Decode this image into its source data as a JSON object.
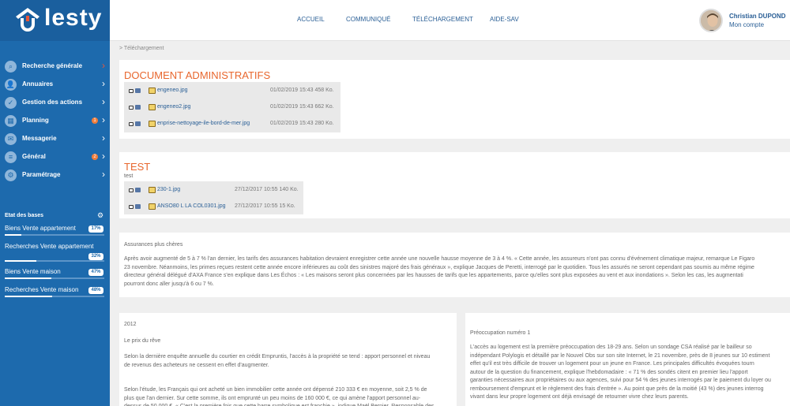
{
  "app": {
    "name": "lesty"
  },
  "nav": {
    "items": [
      {
        "label": "Recherche générale",
        "icon": "search-icon",
        "glyph": "⌕",
        "chev": "red"
      },
      {
        "label": "Annuaires",
        "icon": "user-icon",
        "glyph": "👤",
        "chev": ""
      },
      {
        "label": "Gestion des actions",
        "icon": "check-icon",
        "glyph": "✓",
        "chev": ""
      },
      {
        "label": "Planning",
        "icon": "calendar-icon",
        "glyph": "▦",
        "chev": "",
        "badge": "1"
      },
      {
        "label": "Messagerie",
        "icon": "envelope-icon",
        "glyph": "✉",
        "chev": ""
      },
      {
        "label": "Général",
        "icon": "database-icon",
        "glyph": "≡",
        "chev": "",
        "badge": "2"
      },
      {
        "label": "Paramétrage",
        "icon": "gears-icon",
        "glyph": "⚙",
        "chev": ""
      }
    ]
  },
  "bases": {
    "title": "Etat des bases",
    "items": [
      {
        "label": "Biens Vente appartement",
        "percent": "17%",
        "fraction": 0.17
      },
      {
        "label": "Recherches Vente appartement",
        "percent": "32%",
        "fraction": 0.32
      },
      {
        "label": "Biens Vente maison",
        "percent": "47%",
        "fraction": 0.47
      },
      {
        "label": "Recherches Vente maison",
        "percent": "48%",
        "fraction": 0.48
      }
    ]
  },
  "topnav": {
    "items": [
      "ACCUEIL",
      "COMMUNIQUÉ",
      "TÉLÉCHARGEMENT",
      "AIDE-SAV"
    ]
  },
  "user": {
    "name": "Christian DUPOND",
    "account": "Mon compte"
  },
  "breadcrumb": "> Téléchargement",
  "sections": [
    {
      "title": "DOCUMENT ADMINISTRATIFS",
      "subtitle": "",
      "files": [
        {
          "name": "engeneo.jpg",
          "date": "01/02/2019 15:43 458 Ko."
        },
        {
          "name": "engeneo2.jpg",
          "date": "01/02/2019 15:43 662 Ko."
        },
        {
          "name": "enprise-nettoyage-ile-bord-de-mer.jpg",
          "date": "01/02/2019 15:43 280 Ko."
        }
      ]
    },
    {
      "title": "TEST",
      "subtitle": "test",
      "files": [
        {
          "name": "230-1.jpg",
          "date": "27/12/2017 10:55 140 Ko."
        },
        {
          "name": "ANSO80 L LA COL0301.jpg",
          "date": "27/12/2017 10:55 15 Ko."
        }
      ]
    }
  ],
  "articles": {
    "assurances": {
      "title": "Assurances plus chères",
      "lines": [
        "Après avoir augmenté de 5 à 7 % l'an dernier, les tarifs des assurances habitation devraient enregistrer cette année une nouvelle hausse moyenne de 3 à 4 %. « Cette année, les assureurs n'ont pas connu d'événement climatique majeur, remarque Le Figaro",
        "23 novembre. Néanmoins, les primes reçues restent cette année encore inférieures au coût des sinistres majoré des frais généraux », explique Jacques de Peretti, interrogé par le quotidien. Tous les assurés ne seront cependant pas soumis au même régime",
        "directeur général délégué d'AXA France s'en explique dans Les Échos : « Les maisons seront plus concernées par les hausses de tarifs que les appartements, parce qu'elles sont plus exposées au vent et aux inondations ». Selon les cas, les augmentati",
        "pourront donc aller jusqu'à 6 ou 7 %."
      ]
    },
    "prix": {
      "year": "2012",
      "title": "Le prix du rêve",
      "lines": [
        "Selon la dernière enquête annuelle du courtier en crédit Empruntis, l'accès à la propriété se tend : apport personnel et niveau",
        "de revenus des acheteurs ne cessent en effet d'augmenter.",
        "",
        "",
        "Selon l'étude, les Français qui ont acheté un bien immobilier cette année ont dépensé 210 333 € en moyenne, soit 2,5 % de",
        "plus que l'an dernier. Sur cette somme, ils ont emprunté un peu moins de 160 000 €, ce qui amène l'apport personnel au-",
        "dessus de 50 000 €. « C'est la première fois que cette barre symbolique est franchie », indique Maël Bernier. Responsable des"
      ]
    },
    "preoccupation": {
      "title": "Préoccupation numéro 1",
      "lines": [
        "L'accès au logement est la première préoccupation des 18-29 ans. Selon un sondage CSA réalisé par le bailleur so",
        "indépendant Polylogis et détaillé par le Nouvel Obs sur son site Internet, le 21 novembre, près de 8 jeunes sur 10 estiment",
        "effet qu'il est très difficile de trouver un logement pour un jeune en France. Les principales difficultés évoquées tourn",
        "autour de la question du financement, explique l'hebdomadaire : « 71 % des sondés citent en premier lieu l'apport",
        "garanties nécessaires aux propriétaires ou aux agences, suivi pour 54 % des jeunes interrogés par le paiement du loyer ou",
        "remboursement d'emprunt et le règlement des frais d'entrée ». Au point que près de la moitié (43 %) des jeunes interrog",
        "vivant dans leur propre logement ont déjà envisagé de retourner vivre chez leurs parents."
      ]
    }
  }
}
